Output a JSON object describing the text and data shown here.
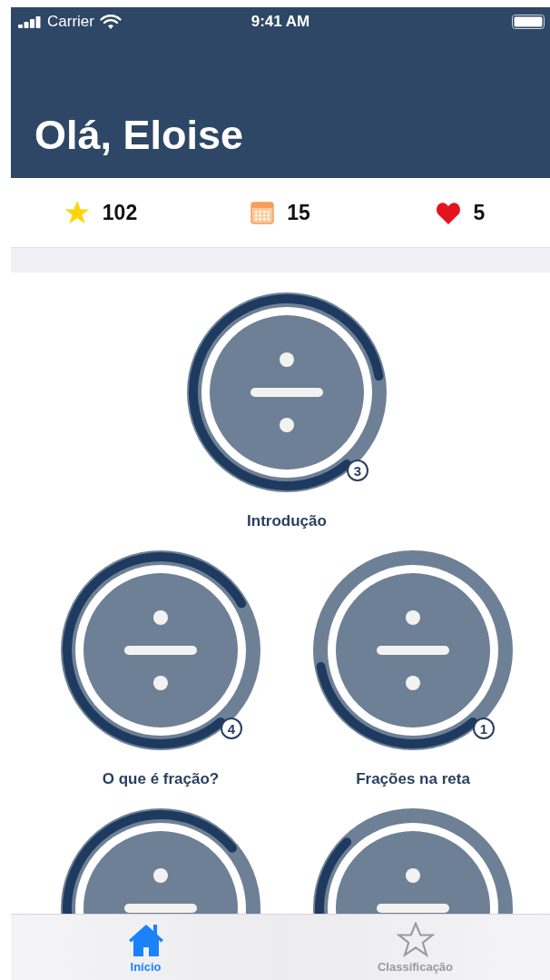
{
  "status_bar": {
    "carrier": "Carrier",
    "time": "9:41 AM"
  },
  "header": {
    "title": "Olá, Eloise"
  },
  "stats": [
    {
      "kind": "star",
      "value": "102"
    },
    {
      "kind": "calendar",
      "value": "15"
    },
    {
      "kind": "heart",
      "value": "5"
    }
  ],
  "lessons": [
    [
      {
        "kind": "lesson",
        "title": "Introdução",
        "badge": "3"
      }
    ],
    [
      {
        "kind": "lesson",
        "title": "O que é fração?",
        "badge": "4"
      },
      {
        "kind": "lesson",
        "title": "Frações na reta",
        "badge": "1"
      }
    ],
    [
      {
        "kind": "lesson"
      },
      {
        "kind": "lesson"
      }
    ]
  ],
  "tab_bar": [
    {
      "kind": "home",
      "label": "Início",
      "selected": true
    },
    {
      "kind": "star",
      "label": "Classificação",
      "selected": false
    }
  ]
}
